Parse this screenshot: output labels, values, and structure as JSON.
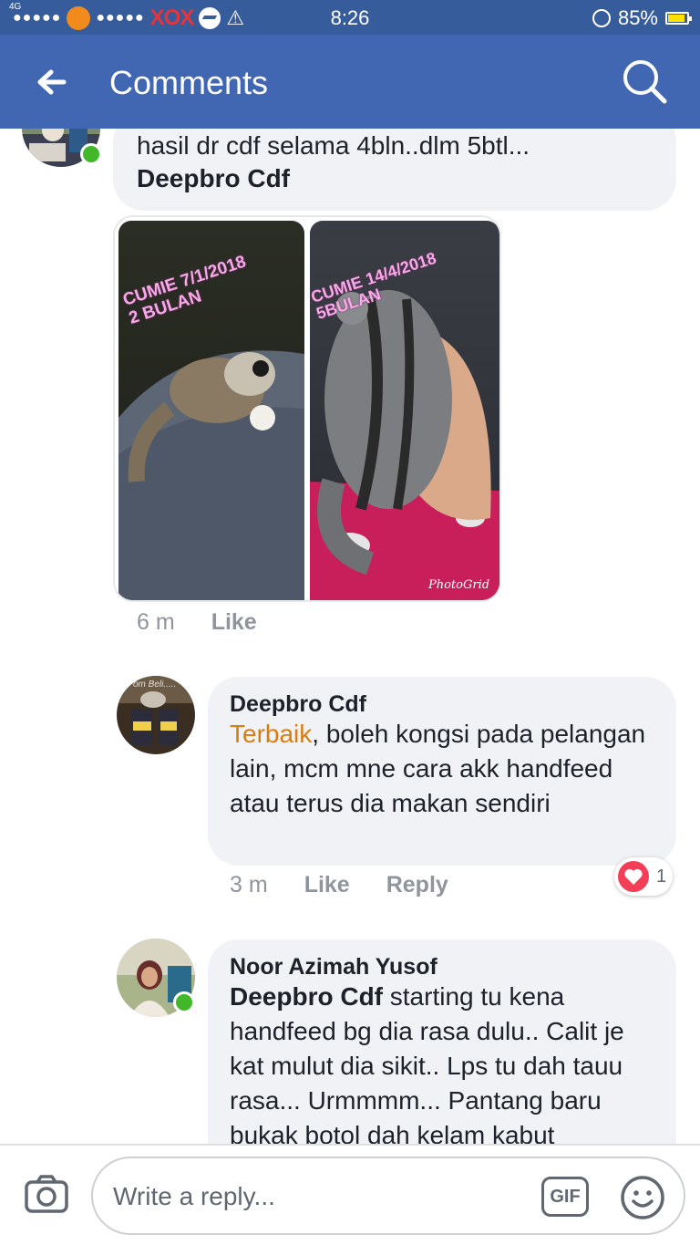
{
  "status_bar": {
    "network": "4G",
    "dots_left": "●●●●●",
    "dots_right": "●●●●●",
    "carrier": "XOX",
    "time": "8:26",
    "battery": "85%"
  },
  "header": {
    "title": "Comments"
  },
  "comments": [
    {
      "text": "hasil dr cdf selama 4bln..dlm 5btl...",
      "mention": "Deepbro Cdf",
      "photo_left_caption": "CUMIE 7/1/2018\n2 BULAN",
      "photo_right_caption": "CUMIE 14/4/2018\n5BULAN",
      "photo_watermark": "PhotoGrid",
      "time": "6 m",
      "like_label": "Like"
    },
    {
      "author": "Deepbro Cdf",
      "highlight": "Terbaik",
      "text": ", boleh kongsi pada pelangan lain, mcm mne cara akk handfeed atau terus dia makan sendiri",
      "time": "3 m",
      "like_label": "Like",
      "reply_label": "Reply",
      "reaction_count": "1",
      "avatar_caption": "om Beli....."
    },
    {
      "author": "Noor Azimah Yusof",
      "mention": "Deepbro Cdf",
      "text": " starting tu kena handfeed bg dia rasa dulu.. Calit je kat mulut dia sikit.. Lps tu dah tauu rasa... Urmmmm... Pantang baru bukak botol dah kelam kabut"
    }
  ],
  "reply_bar": {
    "placeholder": "Write a reply...",
    "gif_label": "GIF"
  },
  "colors": {
    "header": "#4167b2",
    "status_bar": "#365c9b",
    "highlight": "#d97d10",
    "online": "#42b72a",
    "heart": "#f33e58"
  }
}
